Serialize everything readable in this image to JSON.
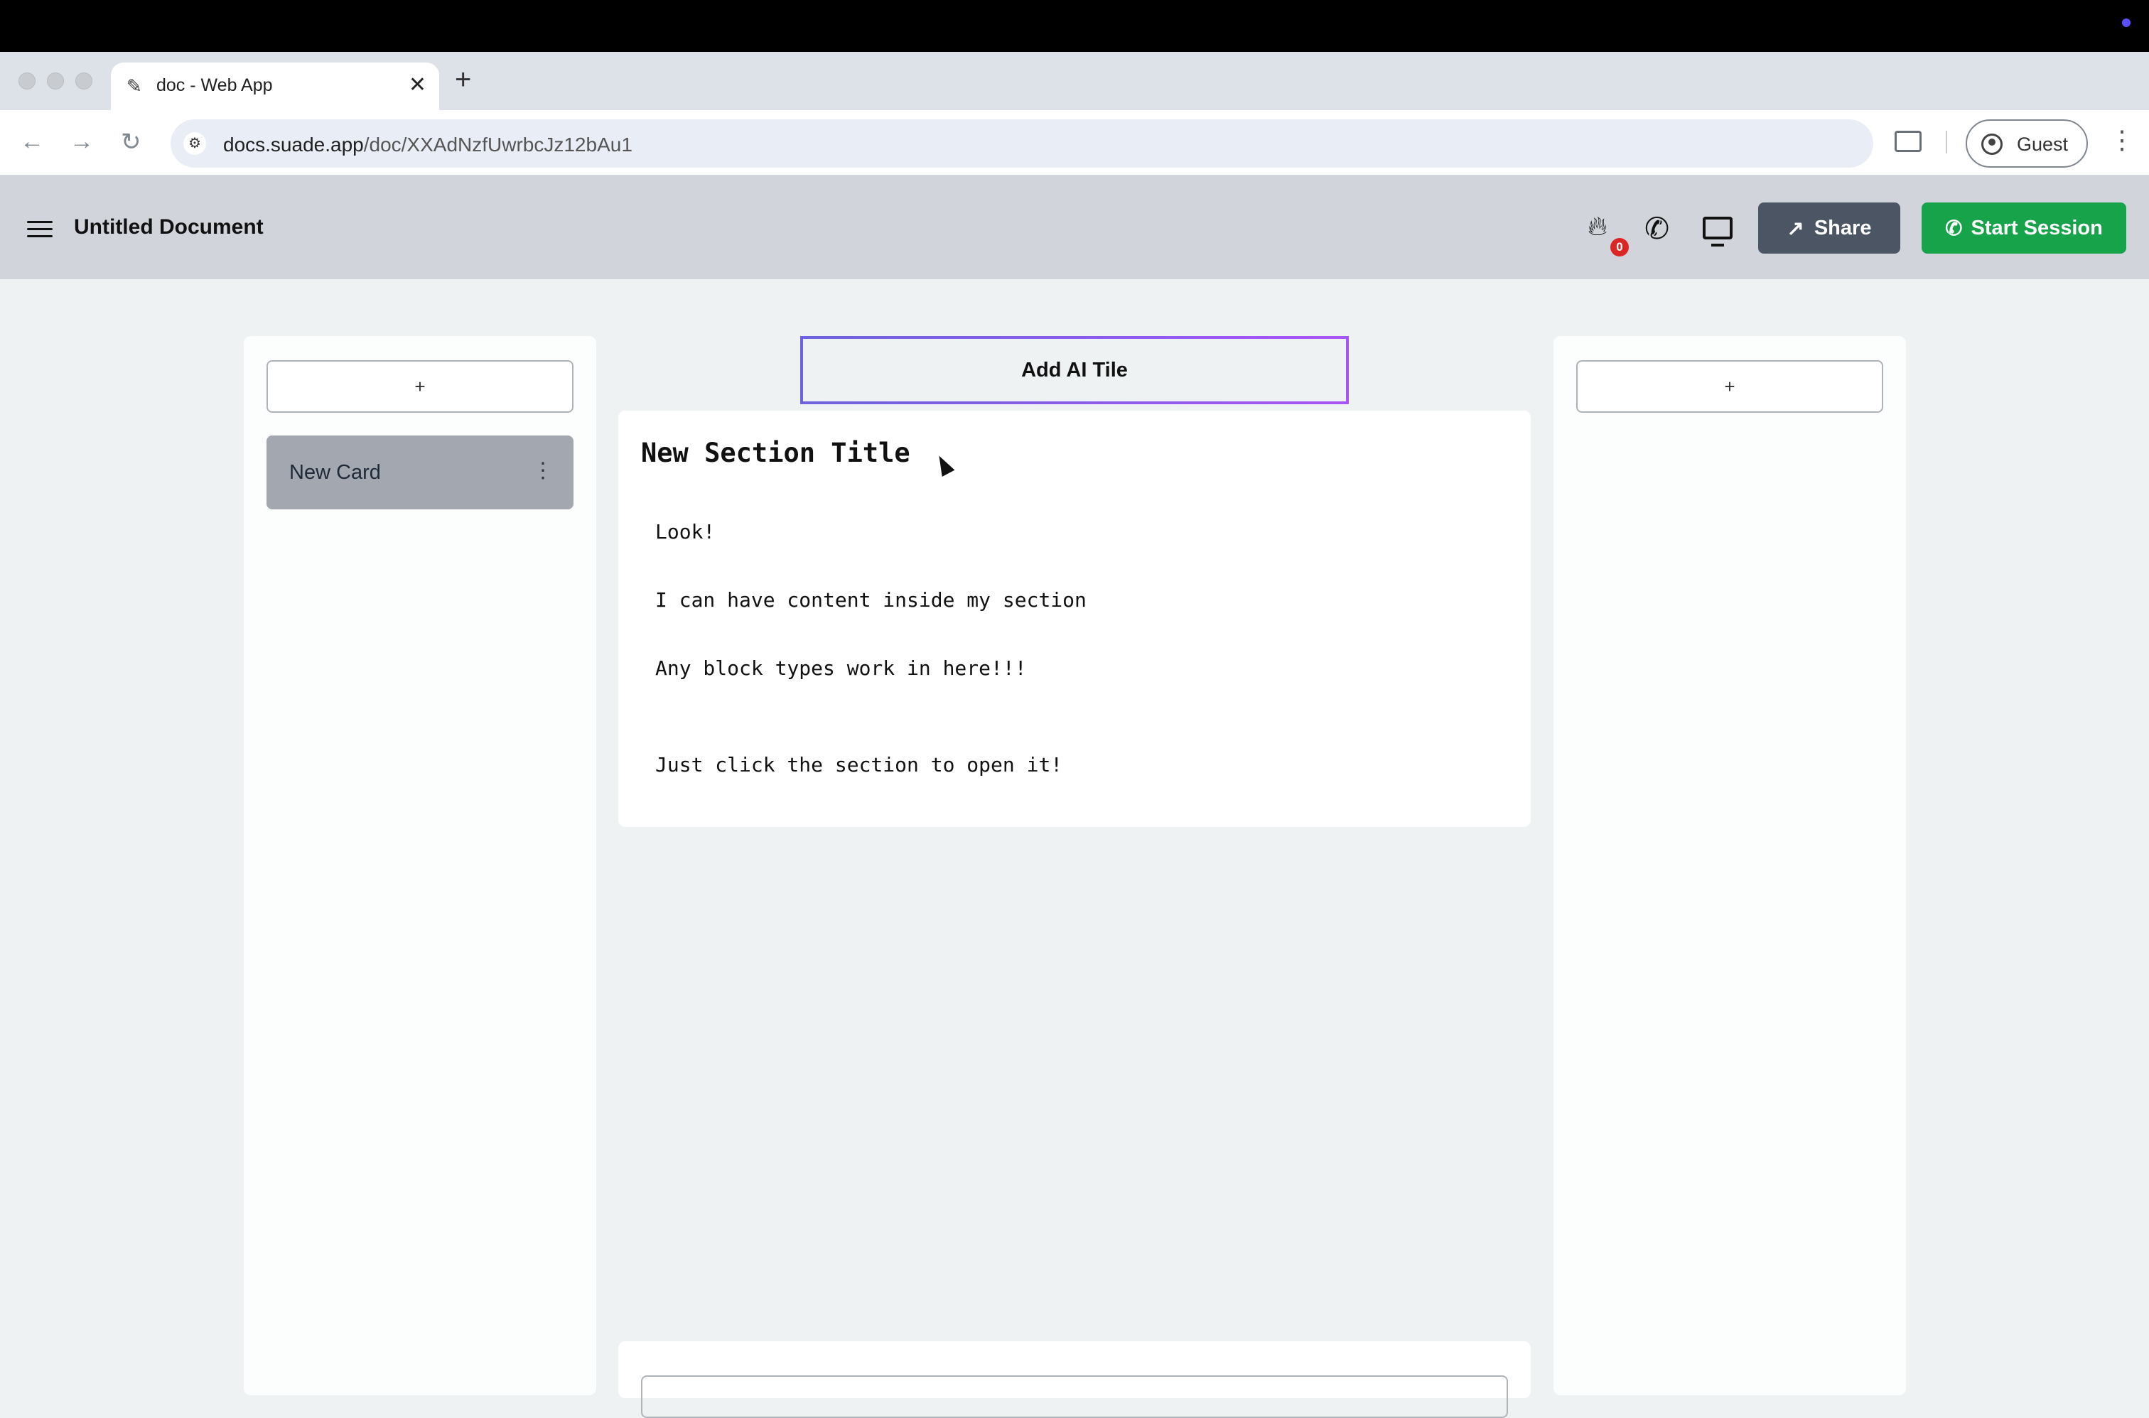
{
  "browser": {
    "tab_title": "doc - Web App",
    "new_tab_label": "+",
    "url_host": "docs.suade.app",
    "url_path": "/doc/XXAdNzfUwrbcJz12bAu1",
    "profile_label": "Guest"
  },
  "header": {
    "doc_title": "Untitled Document",
    "notification_count": "0",
    "share_label": "Share",
    "start_session_label": "Start Session",
    "colors": {
      "share_bg": "#4b5563",
      "start_bg": "#16a34a",
      "badge_bg": "#dc2626"
    }
  },
  "left_column": {
    "add_label": "+",
    "cards": [
      {
        "label": "New Card",
        "menu": "⋮"
      }
    ]
  },
  "right_column": {
    "add_label": "+"
  },
  "center": {
    "ai_tile_label": "Add AI Tile",
    "section": {
      "title": "New Section Title",
      "lines": [
        "Look!",
        "I can have content inside my section",
        "Any block types work in here!!!",
        "Just click the section to open it!"
      ]
    }
  },
  "icons": {
    "fire": "fire-icon",
    "phone": "phone-icon",
    "monitor": "monitor-icon",
    "share": "share-arrow-icon",
    "menu": "hamburger-icon"
  }
}
